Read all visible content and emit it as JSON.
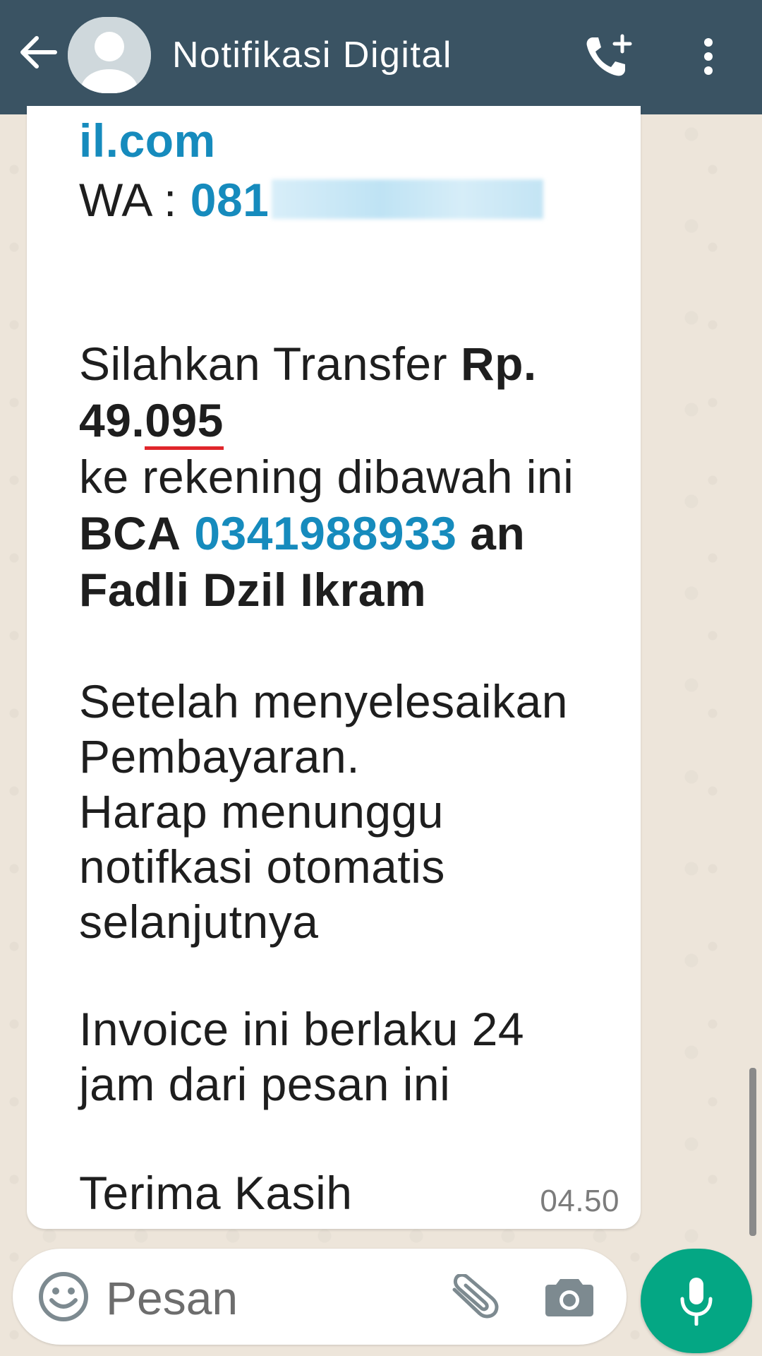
{
  "header": {
    "title": "Notifikasi Digital",
    "back_icon": "arrow-left-icon",
    "call_icon": "add-call-icon",
    "menu_icon": "more-vertical-icon"
  },
  "message": {
    "email_tail": "il.com",
    "wa_label": "WA : ",
    "wa_number_visible": "081",
    "transfer_prefix": "Silahkan Transfer ",
    "amount_prefix": "Rp.",
    "amount_line2_start": "49.",
    "amount_line2_underlined": "095",
    "account_intro": "ke rekening dibawah ini",
    "bank_name": "BCA",
    "account_number": "0341988933",
    "account_an": "an",
    "account_holder": "Fadli Dzil Ikram",
    "after_1": "Setelah menyelesaikan",
    "after_2": "Pembayaran.",
    "after_3": "Harap menunggu",
    "after_4": "notifkasi otomatis",
    "after_5": "selanjutnya",
    "invoice_1": "Invoice ini berlaku 24",
    "invoice_2": "jam dari pesan ini",
    "thanks": "Terima Kasih",
    "time": "04.50"
  },
  "input": {
    "placeholder": "Pesan"
  },
  "colors": {
    "header_bg": "#3a5363",
    "link": "#168bbd",
    "mic_button": "#04a784",
    "underline": "#e0262b"
  }
}
